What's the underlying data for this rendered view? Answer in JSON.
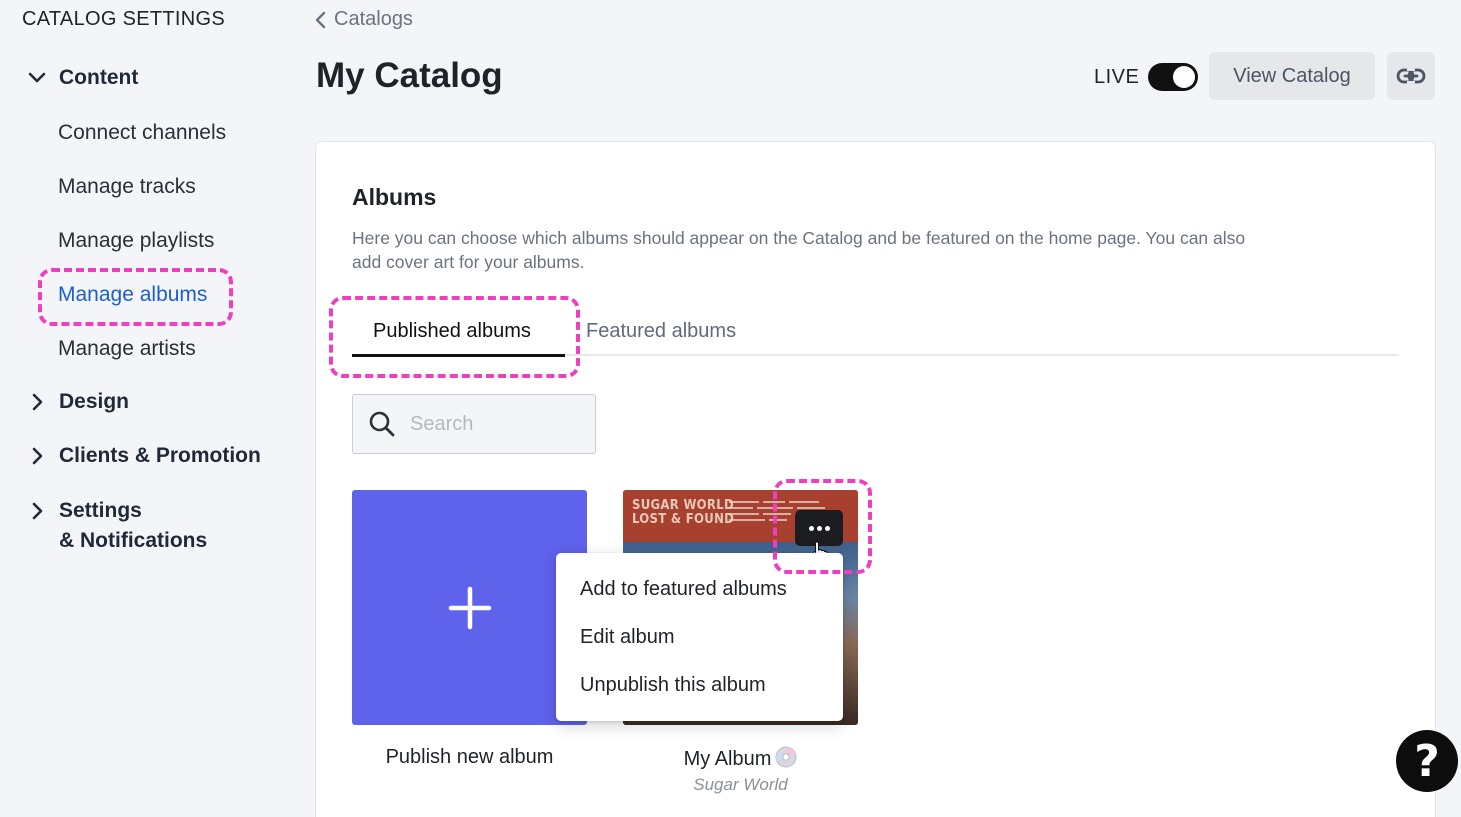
{
  "sidebar": {
    "heading": "CATALOG SETTINGS",
    "sections": [
      {
        "label": "Content",
        "expanded": true
      },
      {
        "label": "Design",
        "expanded": false
      },
      {
        "label": "Clients & Promotion",
        "expanded": false
      },
      {
        "label_line1": "Settings",
        "label_line2": "& Notifications",
        "expanded": false
      }
    ],
    "content_items": [
      {
        "label": "Connect channels"
      },
      {
        "label": "Manage tracks"
      },
      {
        "label": "Manage playlists"
      },
      {
        "label": "Manage albums",
        "active": true
      },
      {
        "label": "Manage artists"
      }
    ]
  },
  "header": {
    "breadcrumb": "Catalogs",
    "title": "My Catalog",
    "live_label": "LIVE",
    "live_on": true,
    "view_button": "View Catalog"
  },
  "albums": {
    "title": "Albums",
    "description": "Here you can choose which albums should appear on the Catalog and be featured on the home page. You can also add cover art for your albums.",
    "tabs": [
      {
        "label": "Published albums",
        "active": true
      },
      {
        "label": "Featured albums",
        "active": false
      }
    ],
    "search_placeholder": "Search",
    "new_tile": {
      "caption": "Publish new album"
    },
    "album": {
      "title": "My Album",
      "artist": "Sugar World",
      "cover_line1": "SUGAR WORLD",
      "cover_line2": "LOST & FOUND"
    },
    "menu": [
      {
        "label": "Add to featured albums"
      },
      {
        "label": "Edit album"
      },
      {
        "label": "Unpublish this album"
      }
    ]
  },
  "help": {
    "label": "?"
  },
  "colors": {
    "accent": "#5f62eb",
    "link_active": "#1a5fd1",
    "highlight": "#ee3fc0"
  }
}
